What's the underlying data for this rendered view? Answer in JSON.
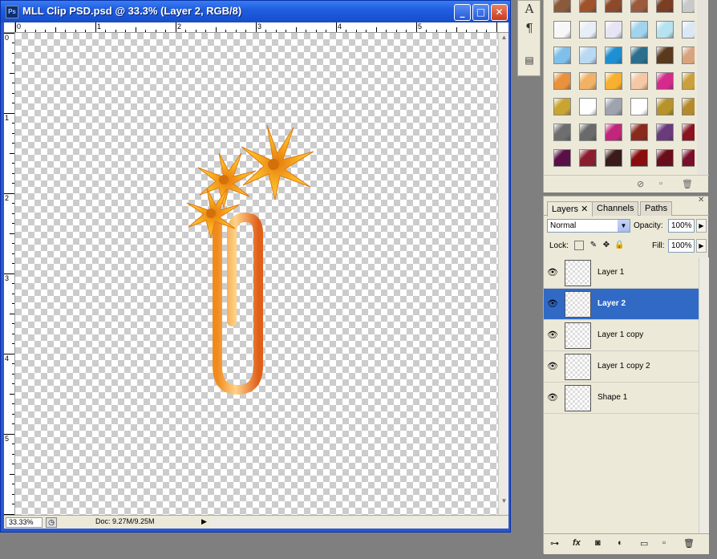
{
  "document": {
    "title": "MLL Clip PSD.psd @ 33.3% (Layer 2, RGB/8)",
    "icon": "photoshop-doc-icon",
    "window_buttons": [
      "minimize",
      "maximize",
      "close"
    ],
    "ruler_top_labels": [
      "0",
      "1",
      "2",
      "3",
      "4",
      "5"
    ],
    "ruler_left_labels": [
      "0",
      "1",
      "2",
      "3",
      "4",
      "5"
    ]
  },
  "status": {
    "zoom": "33.33%",
    "doc_size": "Doc: 9.27M/9.25M"
  },
  "tools": {
    "type_tool": "A",
    "paragraph_tool": "¶"
  },
  "styles": {
    "swatch_colors": [
      "#8a5a3b",
      "#a0522d",
      "#8b4a2b",
      "#9a5b3c",
      "#7a3e22",
      "#c9c9c9",
      "#f7f7f7",
      "#e8eef5",
      "#e6e4f5",
      "#9fd3ee",
      "#b6e3f0",
      "#d9e7f7",
      "#7fc0ea",
      "#b9d8f2",
      "#1e8fd1",
      "#2b6f8c",
      "#5a3a1e",
      "#d8a47e",
      "#e9913b",
      "#f2b266",
      "#f7b02f",
      "#f6c7a4",
      "#d42a8b",
      "#c9a03a",
      "#c9a431",
      "#ffffff",
      "#9ea3ad",
      "#ffffff",
      "#b8922a",
      "#b38b2a",
      "#6e6e6e",
      "#6a6a6a",
      "#c2267a",
      "#8a2a1c",
      "#6a3a7a",
      "#8a1420",
      "#5a1046",
      "#8a1e30",
      "#3a1a1a",
      "#8a0d0d",
      "#6a0d1a",
      "#7a1028"
    ]
  },
  "layers_panel": {
    "tabs": [
      "Layers",
      "Channels",
      "Paths"
    ],
    "blend_mode": "Normal",
    "opacity_label": "Opacity:",
    "opacity": "100%",
    "lock_label": "Lock:",
    "fill_label": "Fill:",
    "fill": "100%",
    "layers": [
      {
        "name": "Layer 1",
        "selected": false
      },
      {
        "name": "Layer 2",
        "selected": true
      },
      {
        "name": "Layer 1 copy",
        "selected": false
      },
      {
        "name": "Layer 1 copy 2",
        "selected": false
      },
      {
        "name": "Shape 1",
        "selected": false
      }
    ],
    "footer_icons": [
      "link-icon",
      "fx-icon",
      "mask-icon",
      "adjustment-icon",
      "folder-icon",
      "new-layer-icon",
      "trash-icon"
    ]
  }
}
